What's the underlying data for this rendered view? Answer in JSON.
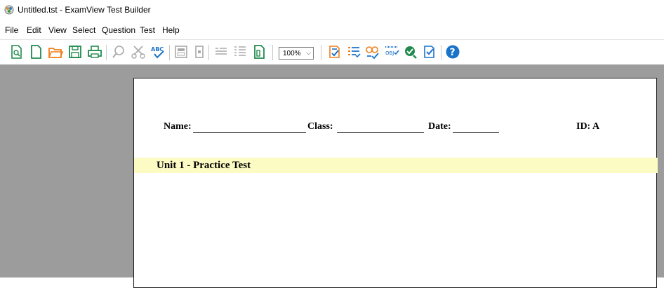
{
  "window": {
    "title": "Untitled.tst - ExamView Test Builder"
  },
  "menu": [
    "File",
    "Edit",
    "View",
    "Select",
    "Question",
    "Test",
    "Help"
  ],
  "toolbar": {
    "zoom": "100%",
    "icons": [
      "new-test-icon",
      "new-page-icon",
      "open-folder-icon",
      "save-icon",
      "print-icon",
      "find-icon",
      "cut-icon",
      "spell-check-icon",
      "calculator-icon",
      "toggle-icon",
      "list-icon",
      "numbered-list-icon",
      "page-icon",
      "select-questions-icon",
      "instructions-icon",
      "answer-key-icon",
      "objectives-icon",
      "verify-icon",
      "assign-icon",
      "help-icon"
    ]
  },
  "page": {
    "name_label": "Name:",
    "class_label": "Class:",
    "date_label": "Date:",
    "id_label": "ID: A",
    "test_title": "Unit 1 - Practice Test"
  },
  "colors": {
    "workspace": "#9c9c9c",
    "title_band": "#fcfbc4",
    "icon_green": "#1f8a4c",
    "icon_orange": "#f07f1a",
    "icon_blue": "#1a73c9"
  }
}
